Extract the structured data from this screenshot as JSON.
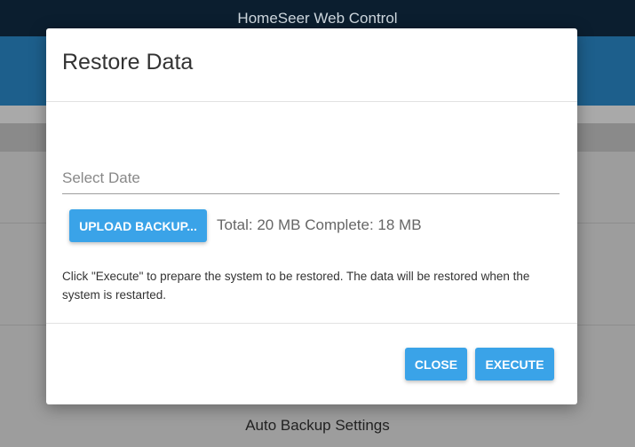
{
  "app": {
    "window_title": "HomeSeer Web Control"
  },
  "background": {
    "section_label": "Auto Backup Settings"
  },
  "dialog": {
    "title": "Restore Data",
    "date_placeholder": "Select Date",
    "date_value": "",
    "upload_button": "UPLOAD BACKUP...",
    "upload_status": "Total: 20 MB Complete: 18 MB",
    "info_text": "Click \"Execute\" to prepare the system to be restored. The data will be restored when the system is restarted.",
    "close_button": "CLOSE",
    "execute_button": "EXECUTE"
  },
  "colors": {
    "accent": "#3aa3e8",
    "header": "#1d5f8c",
    "titlebar": "#0b1e2f"
  }
}
